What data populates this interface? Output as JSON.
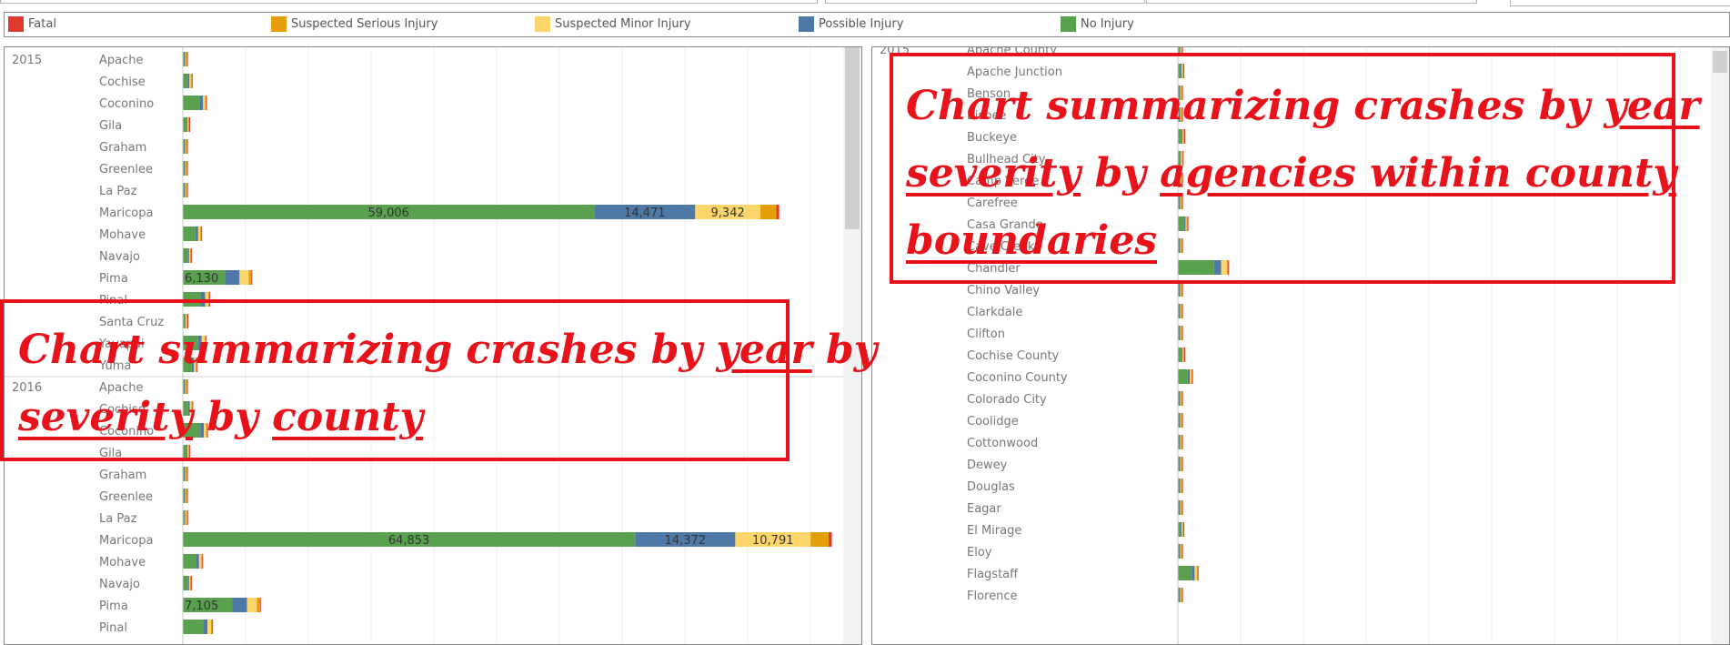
{
  "legend": [
    {
      "label": "Fatal",
      "color": "#e03a2f"
    },
    {
      "label": "Suspected Serious Injury",
      "color": "#e59e0b"
    },
    {
      "label": "Suspected Minor Injury",
      "color": "#fcd66a"
    },
    {
      "label": "Possible Injury",
      "color": "#4e79a7"
    },
    {
      "label": "No Injury",
      "color": "#59a14f"
    }
  ],
  "annotations": {
    "left": {
      "line1": [
        "Chart summarizing crashes by ",
        "year",
        " by"
      ],
      "line2": [
        "severity",
        " by ",
        "county"
      ]
    },
    "right": {
      "line1": [
        "Chart summarizing crashes by ",
        "year"
      ],
      "line2": [
        "severity",
        " by ",
        "agencies within county"
      ],
      "line3": [
        "boundaries"
      ]
    }
  },
  "chart_data": [
    {
      "type": "bar",
      "orientation": "horizontal-stacked",
      "series_order": [
        "No Injury",
        "Possible Injury",
        "Suspected Minor Injury",
        "Suspected Serious Injury",
        "Fatal"
      ],
      "xlim": [
        0,
        90000
      ],
      "groups": [
        {
          "year": "2015",
          "rows": [
            {
              "label": "Apache",
              "values": [
                120,
                60,
                90,
                40,
                30
              ]
            },
            {
              "label": "Cochise",
              "values": [
                700,
                250,
                200,
                60,
                20
              ]
            },
            {
              "label": "Coconino",
              "values": [
                2400,
                500,
                300,
                120,
                30
              ]
            },
            {
              "label": "Gila",
              "values": [
                500,
                150,
                100,
                40,
                20
              ]
            },
            {
              "label": "Graham",
              "values": [
                150,
                60,
                50,
                20,
                10
              ]
            },
            {
              "label": "Greenlee",
              "values": [
                60,
                20,
                20,
                10,
                5
              ]
            },
            {
              "label": "La Paz",
              "values": [
                200,
                70,
                50,
                20,
                10
              ]
            },
            {
              "label": "Maricopa",
              "values": [
                59006,
                14471,
                9342,
                2300,
                400
              ],
              "labels": [
                "59,006",
                "14,471",
                "9,342",
                "",
                ""
              ]
            },
            {
              "label": "Mohave",
              "values": [
                1800,
                400,
                300,
                100,
                40
              ]
            },
            {
              "label": "Navajo",
              "values": [
                700,
                200,
                120,
                50,
                20
              ]
            },
            {
              "label": "Pima",
              "values": [
                6130,
                2000,
                1300,
                400,
                100
              ],
              "labels": [
                "6,130",
                "",
                "",
                "",
                ""
              ]
            },
            {
              "label": "Pinal",
              "values": [
                2600,
                600,
                450,
                150,
                50
              ]
            },
            {
              "label": "Santa Cruz",
              "values": [
                250,
                80,
                60,
                20,
                10
              ]
            },
            {
              "label": "Yavapai",
              "values": [
                2200,
                500,
                400,
                130,
                40
              ]
            },
            {
              "label": "Yuma",
              "values": [
                1300,
                300,
                250,
                80,
                30
              ]
            }
          ]
        },
        {
          "year": "2016",
          "rows": [
            {
              "label": "Apache",
              "values": [
                130,
                60,
                100,
                40,
                30
              ]
            },
            {
              "label": "Cochise",
              "values": [
                750,
                260,
                210,
                60,
                20
              ]
            },
            {
              "label": "Coconino",
              "values": [
                2500,
                520,
                320,
                120,
                30
              ]
            },
            {
              "label": "Gila",
              "values": [
                500,
                160,
                100,
                40,
                20
              ]
            },
            {
              "label": "Graham",
              "values": [
                160,
                60,
                50,
                20,
                10
              ]
            },
            {
              "label": "Greenlee",
              "values": [
                60,
                20,
                20,
                10,
                5
              ]
            },
            {
              "label": "La Paz",
              "values": [
                220,
                70,
                50,
                20,
                10
              ]
            },
            {
              "label": "Maricopa",
              "values": [
                64853,
                14372,
                10791,
                2600,
                450
              ],
              "labels": [
                "64,853",
                "14,372",
                "10,791",
                "",
                ""
              ]
            },
            {
              "label": "Mohave",
              "values": [
                1900,
                420,
                320,
                100,
                40
              ]
            },
            {
              "label": "Navajo",
              "values": [
                700,
                200,
                120,
                50,
                20
              ]
            },
            {
              "label": "Pima",
              "values": [
                7105,
                2100,
                1400,
                450,
                110
              ],
              "labels": [
                "7,105",
                "",
                "",
                "",
                ""
              ]
            },
            {
              "label": "Pinal",
              "values": [
                2900,
                650,
                480,
                160,
                60
              ]
            }
          ]
        }
      ]
    },
    {
      "type": "bar",
      "orientation": "horizontal-stacked",
      "series_order": [
        "No Injury",
        "Possible Injury",
        "Suspected Minor Injury",
        "Suspected Serious Injury",
        "Fatal"
      ],
      "xlim": [
        0,
        90000
      ],
      "groups": [
        {
          "year": "2015",
          "rows": [
            {
              "label": "Apache County",
              "values": [
                200,
                60,
                60,
                30,
                20
              ]
            },
            {
              "label": "Apache Junction",
              "values": [
                400,
                120,
                100,
                40,
                10
              ]
            },
            {
              "label": "Benson",
              "values": [
                30,
                10,
                10,
                5,
                2
              ]
            },
            {
              "label": "Bisbee",
              "values": [
                60,
                20,
                20,
                5,
                2
              ]
            },
            {
              "label": "Buckeye",
              "values": [
                500,
                150,
                120,
                40,
                10
              ]
            },
            {
              "label": "Bullhead City",
              "values": [
                300,
                100,
                80,
                30,
                10
              ]
            },
            {
              "label": "Camp Verde",
              "values": [
                100,
                30,
                30,
                10,
                5
              ]
            },
            {
              "label": "Carefree",
              "values": [
                40,
                10,
                10,
                5,
                2
              ]
            },
            {
              "label": "Casa Grande",
              "values": [
                900,
                200,
                150,
                50,
                10
              ]
            },
            {
              "label": "Cave Creek",
              "values": [
                60,
                20,
                20,
                5,
                2
              ]
            },
            {
              "label": "Chandler",
              "values": [
                5200,
                1000,
                800,
                200,
                40
              ]
            },
            {
              "label": "Chino Valley",
              "values": [
                100,
                30,
                30,
                10,
                5
              ]
            },
            {
              "label": "Clarkdale",
              "values": [
                30,
                10,
                10,
                5,
                2
              ]
            },
            {
              "label": "Clifton",
              "values": [
                20,
                5,
                5,
                2,
                1
              ]
            },
            {
              "label": "Cochise County",
              "values": [
                500,
                150,
                120,
                40,
                20
              ]
            },
            {
              "label": "Coconino County",
              "values": [
                1400,
                300,
                200,
                80,
                30
              ]
            },
            {
              "label": "Colorado City",
              "values": [
                20,
                5,
                5,
                2,
                1
              ]
            },
            {
              "label": "Coolidge",
              "values": [
                150,
                50,
                40,
                15,
                5
              ]
            },
            {
              "label": "Cottonwood",
              "values": [
                200,
                60,
                50,
                20,
                5
              ]
            },
            {
              "label": "Dewey",
              "values": [
                20,
                5,
                5,
                2,
                1
              ]
            },
            {
              "label": "Douglas",
              "values": [
                120,
                40,
                30,
                10,
                5
              ]
            },
            {
              "label": "Eagar",
              "values": [
                20,
                5,
                5,
                2,
                1
              ]
            },
            {
              "label": "El Mirage",
              "values": [
                400,
                100,
                80,
                30,
                10
              ]
            },
            {
              "label": "Eloy",
              "values": [
                100,
                30,
                30,
                10,
                5
              ]
            },
            {
              "label": "Flagstaff",
              "values": [
                2000,
                400,
                300,
                90,
                20
              ]
            },
            {
              "label": "Florence",
              "values": [
                100,
                30,
                30,
                10,
                5
              ]
            }
          ]
        }
      ]
    }
  ]
}
